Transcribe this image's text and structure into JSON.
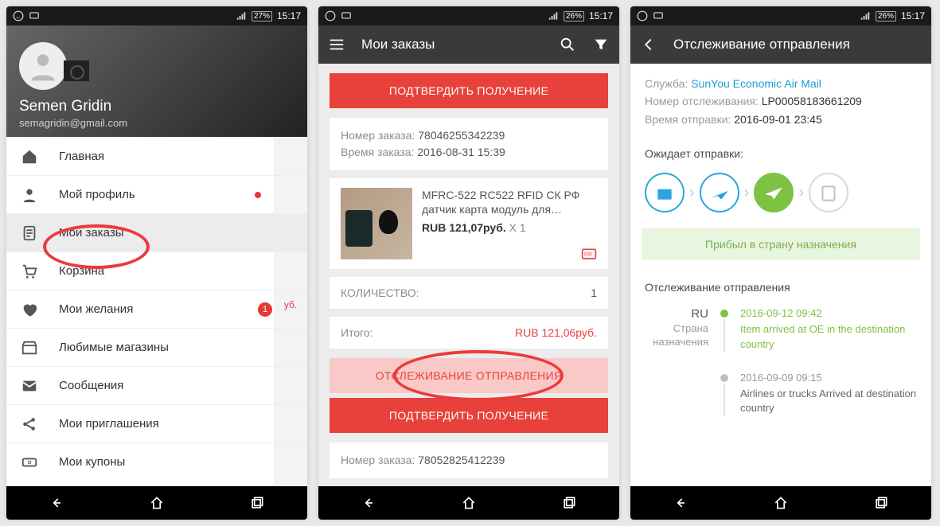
{
  "status": {
    "battery1": "27%",
    "battery2": "26%",
    "battery3": "26%",
    "time": "15:17"
  },
  "screen1": {
    "user_name": "Semen Gridin",
    "user_email": "semagridin@gmail.com",
    "menu": [
      {
        "icon": "home",
        "label": "Главная"
      },
      {
        "icon": "person",
        "label": "Мой профиль",
        "dot": true
      },
      {
        "icon": "orders",
        "label": "Мои заказы",
        "active": true,
        "circled": true
      },
      {
        "icon": "cart",
        "label": "Корзина"
      },
      {
        "icon": "heart",
        "label": "Мои желания",
        "badge": "1"
      },
      {
        "icon": "store",
        "label": "Любимые магазины"
      },
      {
        "icon": "mail",
        "label": "Сообщения"
      },
      {
        "icon": "share",
        "label": "Мои приглашения"
      },
      {
        "icon": "coupon",
        "label": "Мои купоны"
      }
    ],
    "side_price": "уб."
  },
  "screen2": {
    "title": "Мои заказы",
    "confirm": "ПОДТВЕРДИТЬ ПОЛУЧЕНИЕ",
    "track": "ОТСЛЕЖИВАНИЕ ОТПРАВЛЕНИЯ",
    "order_no_label": "Номер заказа:",
    "order_no": "78046255342239",
    "order_time_label": "Время заказа:",
    "order_time": "2016-08-31 15:39",
    "product_title": "MFRC-522 RC522 RFID СК РФ датчик карта модуль для…",
    "product_price": "RUB 121,07руб.",
    "product_qty": "X 1",
    "qty_label": "КОЛИЧЕСТВО:",
    "qty_val": "1",
    "total_label": "Итого:",
    "total_val": "RUB 121,06руб.",
    "next_order_label": "Номер заказа:",
    "next_order_no": "78052825412239"
  },
  "screen3": {
    "title": "Отслеживание отправления",
    "service_label": "Служба:",
    "service": "SunYou Economic Air Mail",
    "track_no_label": "Номер отслеживания:",
    "track_no": "LP00058183661209",
    "ship_time_label": "Время отправки:",
    "ship_time": "2016-09-01 23:45",
    "awaiting": "Ожидает отправки:",
    "banner": "Прибыл в страну назначения",
    "list_title": "Отслеживание отправления",
    "country": "RU",
    "country_sub": "Страна назначения",
    "events": [
      {
        "date": "2016-09-12 09:42",
        "text": "Item arrived at OE in the destination country",
        "on": true
      },
      {
        "date": "2016-09-09 09:15",
        "text": "Airlines or trucks Arrived at destination country",
        "on": false
      }
    ]
  }
}
